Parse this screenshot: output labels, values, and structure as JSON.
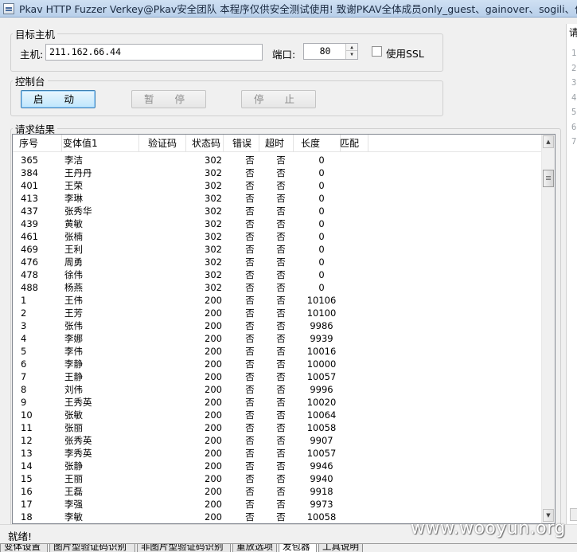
{
  "window": {
    "title": "Pkav HTTP Fuzzer    Verkey@Pkav安全团队   本程序仅供安全测试使用!   致谢PKAV全体成员only_guest、gainover、sogili、伟大的"
  },
  "target": {
    "group_label": "目标主机",
    "host_label": "主机:",
    "host_value": "211.162.66.44",
    "port_label": "端口:",
    "port_value": "80",
    "ssl_label": "使用SSL",
    "ssl_checked": false
  },
  "console": {
    "group_label": "控制台",
    "start_label": "启 动",
    "pause_label": "暂 停",
    "stop_label": "停 止"
  },
  "results": {
    "group_label": "请求结果",
    "columns": [
      "序号",
      "变体值1",
      "验证码",
      "状态码",
      "错误",
      "超时",
      "长度",
      "匹配"
    ],
    "rows": [
      [
        "365",
        "李洁",
        "",
        "302",
        "否",
        "否",
        "0",
        ""
      ],
      [
        "384",
        "王丹丹",
        "",
        "302",
        "否",
        "否",
        "0",
        ""
      ],
      [
        "401",
        "王荣",
        "",
        "302",
        "否",
        "否",
        "0",
        ""
      ],
      [
        "413",
        "李琳",
        "",
        "302",
        "否",
        "否",
        "0",
        ""
      ],
      [
        "437",
        "张秀华",
        "",
        "302",
        "否",
        "否",
        "0",
        ""
      ],
      [
        "439",
        "黄敏",
        "",
        "302",
        "否",
        "否",
        "0",
        ""
      ],
      [
        "461",
        "张楠",
        "",
        "302",
        "否",
        "否",
        "0",
        ""
      ],
      [
        "469",
        "王利",
        "",
        "302",
        "否",
        "否",
        "0",
        ""
      ],
      [
        "476",
        "周勇",
        "",
        "302",
        "否",
        "否",
        "0",
        ""
      ],
      [
        "478",
        "徐伟",
        "",
        "302",
        "否",
        "否",
        "0",
        ""
      ],
      [
        "488",
        "杨燕",
        "",
        "302",
        "否",
        "否",
        "0",
        ""
      ],
      [
        "1",
        "王伟",
        "",
        "200",
        "否",
        "否",
        "10106",
        ""
      ],
      [
        "2",
        "王芳",
        "",
        "200",
        "否",
        "否",
        "10100",
        ""
      ],
      [
        "3",
        "张伟",
        "",
        "200",
        "否",
        "否",
        "9986",
        ""
      ],
      [
        "4",
        "李娜",
        "",
        "200",
        "否",
        "否",
        "9939",
        ""
      ],
      [
        "5",
        "李伟",
        "",
        "200",
        "否",
        "否",
        "10016",
        ""
      ],
      [
        "6",
        "李静",
        "",
        "200",
        "否",
        "否",
        "10000",
        ""
      ],
      [
        "7",
        "王静",
        "",
        "200",
        "否",
        "否",
        "10057",
        ""
      ],
      [
        "8",
        "刘伟",
        "",
        "200",
        "否",
        "否",
        "9996",
        ""
      ],
      [
        "9",
        "王秀英",
        "",
        "200",
        "否",
        "否",
        "10020",
        ""
      ],
      [
        "10",
        "张敏",
        "",
        "200",
        "否",
        "否",
        "10064",
        ""
      ],
      [
        "11",
        "张丽",
        "",
        "200",
        "否",
        "否",
        "10058",
        ""
      ],
      [
        "12",
        "张秀英",
        "",
        "200",
        "否",
        "否",
        "9907",
        ""
      ],
      [
        "13",
        "李秀英",
        "",
        "200",
        "否",
        "否",
        "10057",
        ""
      ],
      [
        "14",
        "张静",
        "",
        "200",
        "否",
        "否",
        "9946",
        ""
      ],
      [
        "15",
        "王丽",
        "",
        "200",
        "否",
        "否",
        "9940",
        ""
      ],
      [
        "16",
        "王磊",
        "",
        "200",
        "否",
        "否",
        "9918",
        ""
      ],
      [
        "17",
        "李强",
        "",
        "200",
        "否",
        "否",
        "9973",
        ""
      ],
      [
        "18",
        "李敏",
        "",
        "200",
        "否",
        "否",
        "10058",
        ""
      ]
    ]
  },
  "right_panel": {
    "header": "请",
    "line_numbers": [
      "1",
      "2",
      "3",
      "4",
      "5",
      "6",
      "7"
    ]
  },
  "status": {
    "text": "就绪!"
  },
  "watermark": "www.wooyun.org",
  "tabs": [
    {
      "label": "变体设置",
      "selected": false
    },
    {
      "label": "图片型验证码识别",
      "selected": false
    },
    {
      "label": "非图片型验证码识别",
      "selected": false
    },
    {
      "label": "重放选项",
      "selected": false
    },
    {
      "label": "发包器",
      "selected": true
    },
    {
      "label": "工具说明",
      "selected": false
    }
  ],
  "icons": {
    "app": "app-icon",
    "spin_up": "spin-up-icon",
    "spin_down": "spin-down-icon",
    "scroll_up": "scroll-up-arrow-icon",
    "scroll_down": "scroll-down-arrow-icon"
  }
}
